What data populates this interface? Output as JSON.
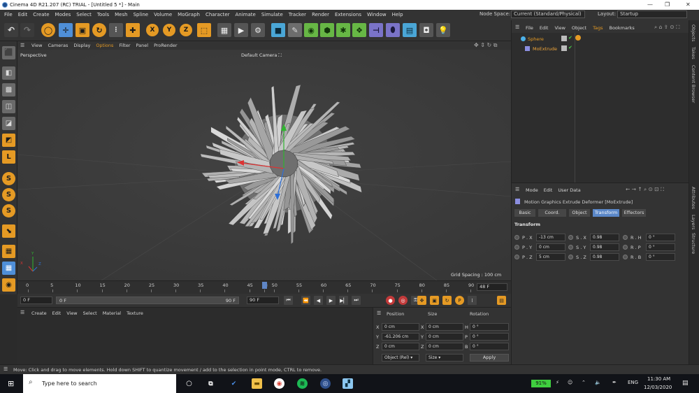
{
  "window": {
    "title": "Cinema 4D R21.207 (RC) TRIAL - [Untitled 5 *] - Main",
    "minimize": "—",
    "maximize": "❐",
    "close": "✕"
  },
  "menu": {
    "items": [
      "File",
      "Edit",
      "Create",
      "Modes",
      "Select",
      "Tools",
      "Mesh",
      "Spline",
      "Volume",
      "MoGraph",
      "Character",
      "Animate",
      "Simulate",
      "Tracker",
      "Render",
      "Extensions",
      "Window",
      "Help"
    ],
    "node_space_label": "Node Space:",
    "node_space_value": "Current (Standard/Physical)",
    "layout_label": "Layout:",
    "layout_value": "Startup"
  },
  "toolbar": {
    "undo": "↶",
    "redo": "↷",
    "x_axis": "X",
    "y_axis": "Y",
    "z_axis": "Z"
  },
  "viewport": {
    "menu": [
      "View",
      "Cameras",
      "Display",
      "Options",
      "Filter",
      "Panel",
      "ProRender"
    ],
    "active_menu": "Options",
    "view_name": "Perspective",
    "camera": "Default Camera",
    "grid_spacing": "Grid Spacing : 100 cm",
    "axis_y": "Y",
    "axis_x": "X",
    "axis_z": "Z"
  },
  "timeline": {
    "ticks": [
      "0",
      "5",
      "10",
      "15",
      "20",
      "25",
      "30",
      "35",
      "40",
      "45",
      "48",
      "50",
      "55",
      "60",
      "65",
      "70",
      "75",
      "80",
      "85",
      "90"
    ],
    "current_frame": "48 F",
    "playhead_frame": 48,
    "max_frame": 90
  },
  "playback": {
    "start_field": "0 F",
    "range_start": "0 F",
    "range_end": "90 F",
    "end_field": "90 F"
  },
  "material_manager": {
    "menu": [
      "Create",
      "Edit",
      "View",
      "Select",
      "Material",
      "Texture"
    ]
  },
  "coordinates": {
    "headers": {
      "position": "Position",
      "size": "Size",
      "rotation": "Rotation"
    },
    "rows": [
      {
        "axis": "X",
        "pos": "0 cm",
        "size_axis": "X",
        "size": "0 cm",
        "rot_axis": "H",
        "rot": "0 °"
      },
      {
        "axis": "Y",
        "pos": "-61.206 cm",
        "size_axis": "Y",
        "size": "0 cm",
        "rot_axis": "P",
        "rot": "0 °"
      },
      {
        "axis": "Z",
        "pos": "0 cm",
        "size_axis": "Z",
        "size": "0 cm",
        "rot_axis": "B",
        "rot": "0 °"
      }
    ],
    "mode": "Object (Rel)",
    "size_mode": "Size",
    "apply": "Apply"
  },
  "object_manager": {
    "menu": [
      "File",
      "Edit",
      "View",
      "Object",
      "Tags",
      "Bookmarks"
    ],
    "objects": [
      {
        "name": "Sphere"
      },
      {
        "name": "MoExtrude"
      }
    ]
  },
  "attributes": {
    "menu": [
      "Mode",
      "Edit",
      "User Data"
    ],
    "object_title": "Motion Graphics Extrude Deformer [MoExtrude]",
    "tabs": [
      "Basic",
      "Coord.",
      "Object",
      "Transform",
      "Effectors"
    ],
    "active_tab": "Transform",
    "section": "Transform",
    "rows": [
      {
        "p_label": "P . X",
        "p_val": "-13 cm",
        "s_label": "S . X",
        "s_val": "0.98",
        "r_label": "R . H",
        "r_val": "0 °"
      },
      {
        "p_label": "P . Y",
        "p_val": "0 cm",
        "s_label": "S . Y",
        "s_val": "0.98",
        "r_label": "R . P",
        "r_val": "0 °"
      },
      {
        "p_label": "P . Z",
        "p_val": "5 cm",
        "s_label": "S . Z",
        "s_val": "0.98",
        "r_label": "R . B",
        "r_val": "0 °"
      }
    ]
  },
  "right_tabs": [
    "Objects",
    "Takes",
    "Content Browser",
    "Attributes",
    "Layers",
    "Structure"
  ],
  "status": {
    "text": "Move: Click and drag to move elements. Hold down SHIFT to quantize movement / add to the selection in point mode, CTRL to remove."
  },
  "taskbar": {
    "search_placeholder": "Type here to search",
    "battery": "91%",
    "language": "ENG",
    "time": "11:30 AM",
    "date": "12/03/2020"
  },
  "colors": {
    "accent_orange": "#e59a24",
    "accent_blue": "#5a87c8",
    "panel_bg": "#333333",
    "viewport_bg": "#3b3b3b"
  }
}
